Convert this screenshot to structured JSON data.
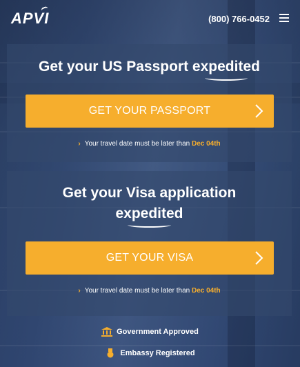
{
  "header": {
    "logo_text": "APVI",
    "phone": "(800) 766-0452",
    "menu_icon": "hamburger-icon"
  },
  "passport_panel": {
    "headline_prefix": "Get your US Passport ",
    "headline_accent": "expedited",
    "button_label": "GET YOUR PASSPORT",
    "note_text": "Your travel date must be later than ",
    "note_date": "Dec 04th"
  },
  "visa_panel": {
    "headline_line1": "Get your Visa application",
    "headline_accent": "expedited",
    "button_label": "GET YOUR VISA",
    "note_text": "Your travel date must be later than ",
    "note_date": "Dec 04th"
  },
  "badges": [
    {
      "label": "Government Approved",
      "icon": "government-building-icon"
    },
    {
      "label": "Embassy Registered",
      "icon": "medal-icon"
    }
  ],
  "colors": {
    "accent": "#f6ae2d",
    "panel": "#34486c"
  }
}
